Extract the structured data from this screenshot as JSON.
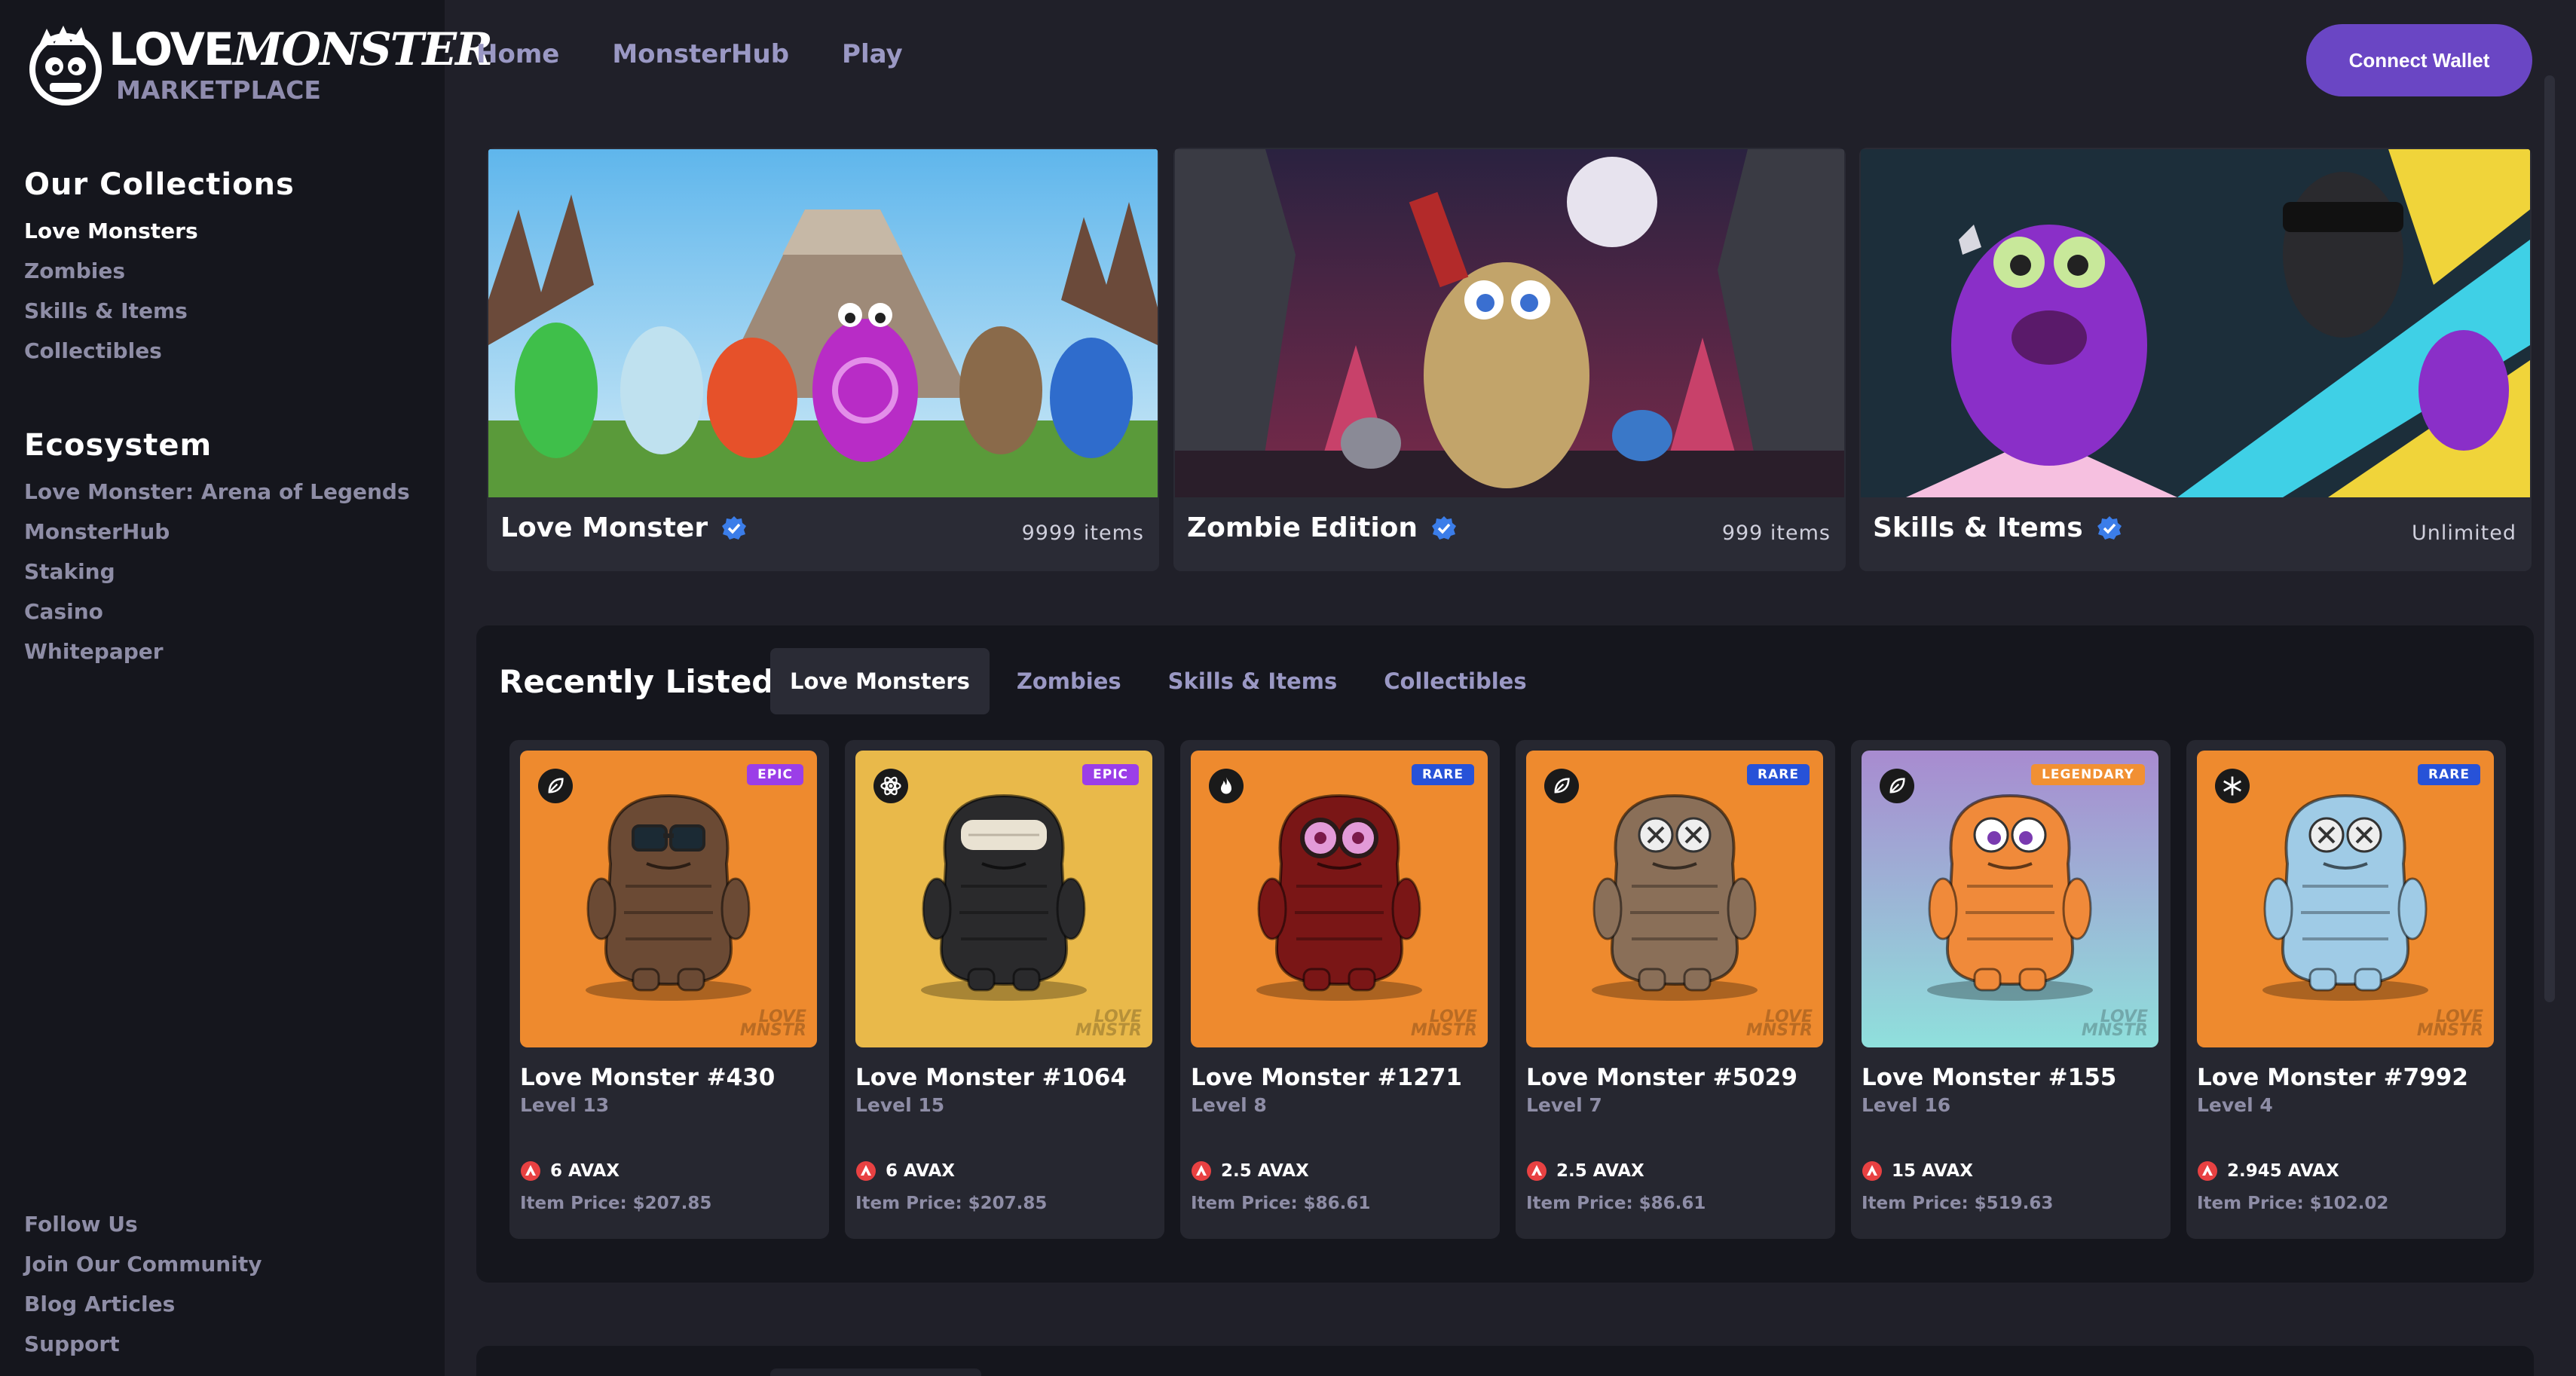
{
  "logo": {
    "word_a": "LOVE",
    "word_b": "MONSTER",
    "sub": "MARKETPLACE"
  },
  "sidebar": {
    "collections_heading": "Our Collections",
    "collections": [
      {
        "label": "Love Monsters",
        "active": true
      },
      {
        "label": "Zombies"
      },
      {
        "label": "Skills & Items"
      },
      {
        "label": "Collectibles"
      }
    ],
    "ecosystem_heading": "Ecosystem",
    "ecosystem": [
      {
        "label": "Love Monster: Arena of Legends"
      },
      {
        "label": "MonsterHub"
      },
      {
        "label": "Staking"
      },
      {
        "label": "Casino"
      },
      {
        "label": "Whitepaper"
      }
    ],
    "footer": [
      {
        "label": "Follow Us"
      },
      {
        "label": "Join Our Community"
      },
      {
        "label": "Blog Articles"
      },
      {
        "label": "Support"
      }
    ]
  },
  "topnav": [
    {
      "label": "Home"
    },
    {
      "label": "MonsterHub"
    },
    {
      "label": "Play"
    }
  ],
  "connect_label": "Connect Wallet",
  "collections": [
    {
      "title": "Love Monster",
      "count": "9999 items"
    },
    {
      "title": "Zombie Edition",
      "count": "999 items"
    },
    {
      "title": "Skills & Items",
      "count": "Unlimited"
    }
  ],
  "recent": {
    "title": "Recently Listed",
    "tabs": [
      {
        "label": "Love Monsters",
        "active": true
      },
      {
        "label": "Zombies"
      },
      {
        "label": "Skills & Items"
      },
      {
        "label": "Collectibles"
      }
    ],
    "items": [
      {
        "name": "Love Monster #430",
        "level": "Level 13",
        "price": "6 AVAX",
        "usd": "Item Price: $207.85",
        "rarity": "EPIC",
        "element": "leaf",
        "bg": "#ee8a2e",
        "body": "#6b4a34",
        "eye": "glasses"
      },
      {
        "name": "Love Monster #1064",
        "level": "Level 15",
        "price": "6 AVAX",
        "usd": "Item Price: $207.85",
        "rarity": "EPIC",
        "element": "atom",
        "bg": "#e9b94a",
        "body": "#2a2a2c",
        "eye": "bandage"
      },
      {
        "name": "Love Monster #1271",
        "level": "Level 8",
        "price": "2.5 AVAX",
        "usd": "Item Price: $86.61",
        "rarity": "RARE",
        "element": "fire",
        "bg": "#ee8a2e",
        "body": "#7a1616",
        "eye": "goggles"
      },
      {
        "name": "Love Monster #5029",
        "level": "Level 7",
        "price": "2.5 AVAX",
        "usd": "Item Price: $86.61",
        "rarity": "RARE",
        "element": "leaf",
        "bg": "#ee8a2e",
        "body": "#8a6f58",
        "eye": "x"
      },
      {
        "name": "Love Monster #155",
        "level": "Level 16",
        "price": "15 AVAX",
        "usd": "Item Price: $519.63",
        "rarity": "LEGENDARY",
        "element": "leaf",
        "bg": "gradient",
        "body": "#f08a3a",
        "eye": "normal"
      },
      {
        "name": "Love Monster #7992",
        "level": "Level 4",
        "price": "2.945 AVAX",
        "usd": "Item Price: $102.02",
        "rarity": "RARE",
        "element": "snow",
        "bg": "#ee8a2e",
        "body": "#9fcbe6",
        "eye": "x"
      }
    ],
    "watermark": "LOVE MNSTR"
  }
}
